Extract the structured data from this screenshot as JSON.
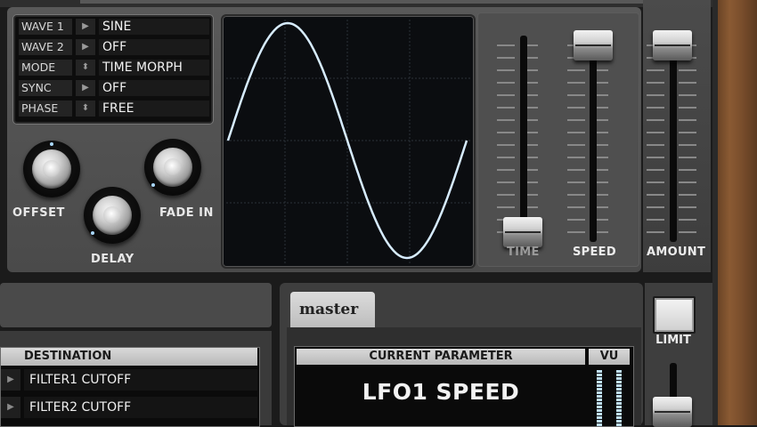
{
  "lfo": {
    "params": [
      {
        "name": "WAVE 1",
        "arrow": "right",
        "value": "SINE"
      },
      {
        "name": "WAVE 2",
        "arrow": "right",
        "value": "OFF"
      },
      {
        "name": "MODE",
        "arrow": "updown",
        "value": "TIME MORPH"
      },
      {
        "name": "SYNC",
        "arrow": "right",
        "value": "OFF"
      },
      {
        "name": "PHASE",
        "arrow": "updown",
        "value": "FREE"
      }
    ],
    "knobs": {
      "offset": {
        "label": "OFFSET",
        "value": 0.5
      },
      "delay": {
        "label": "DELAY",
        "value": 0.0
      },
      "fade_in": {
        "label": "FADE IN",
        "value": 0.0
      }
    },
    "scope": {
      "waveform": "sine",
      "trace_color": "#d7ecff"
    },
    "sliders": {
      "time": {
        "label": "TIME",
        "value": 0.0
      },
      "speed": {
        "label": "SPEED",
        "value": 1.0
      },
      "amount": {
        "label": "AMOUNT",
        "value": 1.0
      }
    }
  },
  "destination": {
    "header": "DESTINATION",
    "rows": [
      "FILTER1 CUTOFF",
      "FILTER2 CUTOFF"
    ]
  },
  "master": {
    "tab_label": "master",
    "current_parameter_header": "CURRENT PARAMETER",
    "current_parameter_value": "LFO1 SPEED",
    "vu_header": "VU",
    "limit_label": "LIMIT"
  },
  "icons": {
    "arrow_right": "▶",
    "arrow_updown": "⬍"
  },
  "colors": {
    "scope_trace": "#d7ecff",
    "knob_dot": "#aad8ff"
  }
}
